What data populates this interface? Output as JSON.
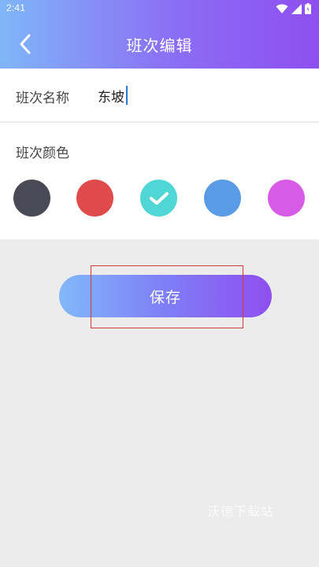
{
  "status_bar": {
    "time": "2:41"
  },
  "header": {
    "title": "班次编辑",
    "back_icon": "chevron-left-icon"
  },
  "form": {
    "name_label": "班次名称",
    "name_value": "东坡",
    "color_label": "班次颜色",
    "colors": [
      {
        "name": "dark-gray",
        "hex": "#4a4a56",
        "selected": false
      },
      {
        "name": "red",
        "hex": "#df4a4a",
        "selected": false
      },
      {
        "name": "cyan",
        "hex": "#51d6d6",
        "selected": true
      },
      {
        "name": "blue",
        "hex": "#5a9be6",
        "selected": false
      },
      {
        "name": "purple",
        "hex": "#d85be5",
        "selected": false
      }
    ]
  },
  "actions": {
    "save_label": "保存"
  },
  "watermark": {
    "text": "沃德下载站"
  },
  "theme": {
    "gradient_start": "#7fb6f8",
    "gradient_end": "#8e4ff0",
    "background": "#ececec"
  }
}
